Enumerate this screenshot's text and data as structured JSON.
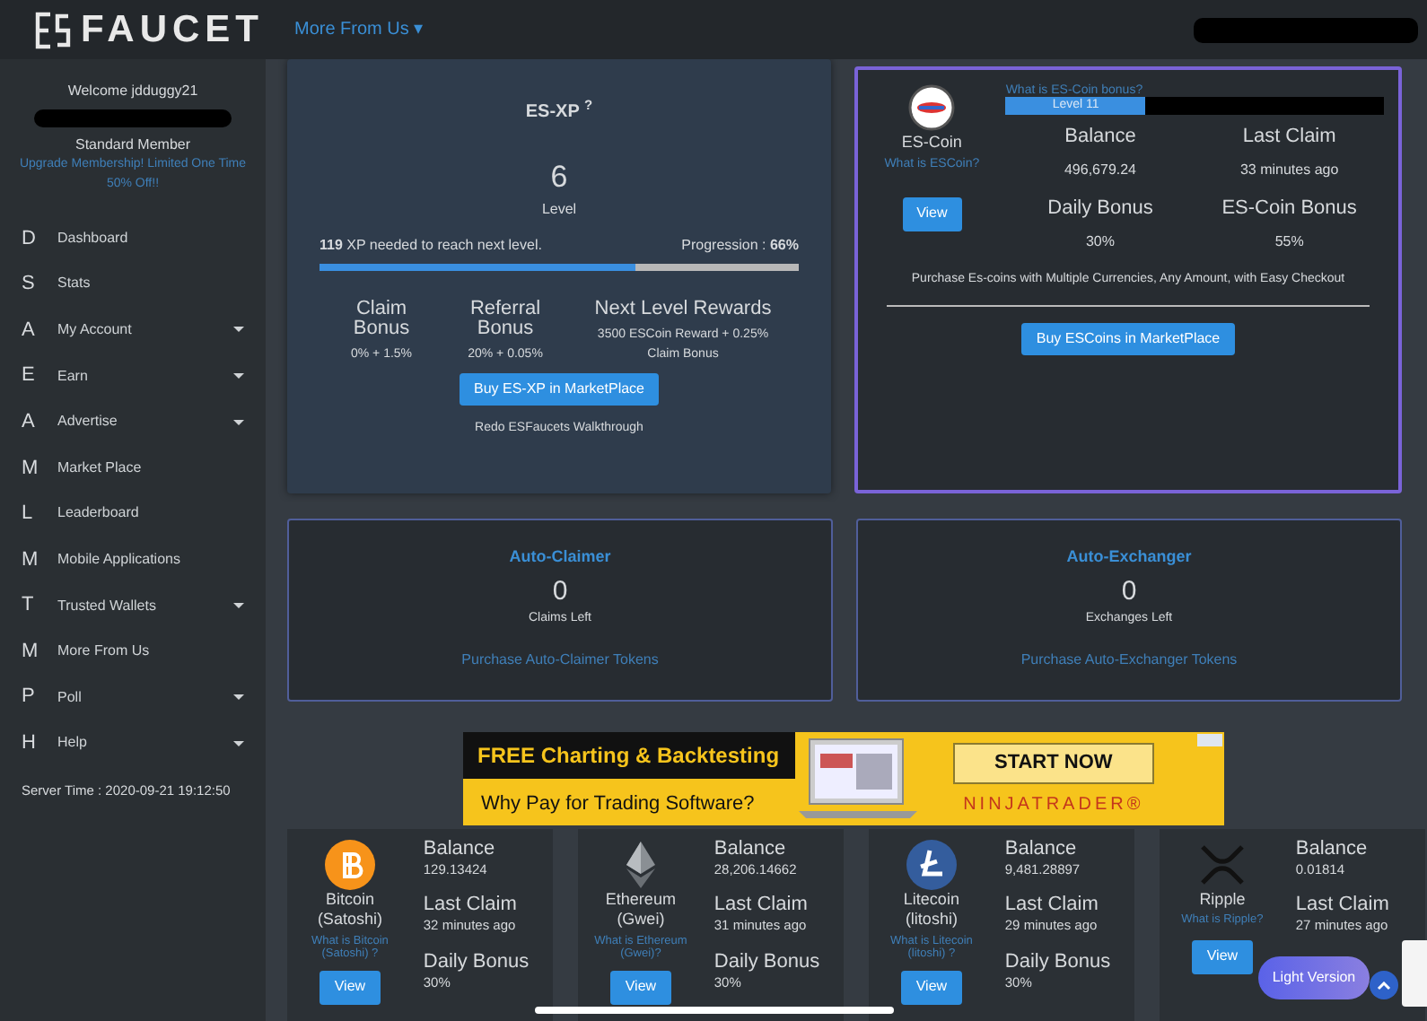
{
  "navbar": {
    "brand": "FAUCET",
    "menu": "More From Us",
    "menu_caret": "▾"
  },
  "sidebar": {
    "welcome": "Welcome jdduggy21",
    "membership": "Standard Member",
    "upgrade_link": "Upgrade Membership! Limited One Time 50% Off!!",
    "items": [
      {
        "letter": "D",
        "label": "Dashboard",
        "expandable": false
      },
      {
        "letter": "S",
        "label": "Stats",
        "expandable": false
      },
      {
        "letter": "A",
        "label": "My Account",
        "expandable": true
      },
      {
        "letter": "E",
        "label": "Earn",
        "expandable": true
      },
      {
        "letter": "A",
        "label": "Advertise",
        "expandable": true
      },
      {
        "letter": "M",
        "label": "Market Place",
        "expandable": false
      },
      {
        "letter": "L",
        "label": "Leaderboard",
        "expandable": false
      },
      {
        "letter": "M",
        "label": "Mobile Applications",
        "expandable": false
      },
      {
        "letter": "T",
        "label": "Trusted Wallets",
        "expandable": true
      },
      {
        "letter": "M",
        "label": "More From Us",
        "expandable": false
      },
      {
        "letter": "P",
        "label": "Poll",
        "expandable": true
      },
      {
        "letter": "H",
        "label": "Help",
        "expandable": true
      }
    ],
    "server_time": "Server Time : 2020-09-21 19:12:50"
  },
  "xp_card": {
    "title": "ES-XP $^{?}$",
    "level_value": "6",
    "level_label": "Level",
    "xp_needed": "**119** XP needed to reach next level.",
    "progression": "Progression : **66%**",
    "level": 0.66,
    "stats": [
      {
        "label": "Claim Bonus",
        "value": "0% + 1.5%"
      },
      {
        "label": "Referral Bonus",
        "value": "20% + 0.05%"
      },
      {
        "label": "Next Level Rewards",
        "value": "3500 ESCoin Reward + 0.25% Claim Bonus"
      }
    ],
    "buy_button": "Buy ES-XP in MarketPlace",
    "walkthrough": "Redo ESFaucets Walkthrough"
  },
  "coin_card": {
    "name": "ES-Coin",
    "what_link": "What is ESCoin?",
    "view_button": "View",
    "bonus_link": "What is ES-Coin bonus?",
    "bonus_level_label": "Level 11",
    "level": 0.37,
    "stats": [
      {
        "label": "Balance",
        "value": "496,679.24"
      },
      {
        "label": "Last Claim",
        "value": "33 minutes ago"
      },
      {
        "label": "Daily Bonus",
        "value": "30%"
      },
      {
        "label": "ES-Coin Bonus",
        "value": "55%"
      }
    ],
    "purchase_text": "Purchase Es-coins with Multiple Currencies, Any Amount, with Easy Checkout",
    "buy_button": "Buy ESCoins in MarketPlace"
  },
  "auto_cards": [
    {
      "title": "Auto-Claimer",
      "count": "0",
      "count_label": "Claims Left",
      "link": "Purchase Auto-Claimer Tokens"
    },
    {
      "title": "Auto-Exchanger",
      "count": "0",
      "count_label": "Exchanges Left",
      "link": "Purchase Auto-Exchanger Tokens"
    }
  ],
  "ad_banner": {
    "headline": "FREE Charting & Backtesting",
    "subline": "Why Pay for Trading Software?",
    "cta": "START NOW",
    "brand": "NINJATRADER®"
  },
  "currencies": [
    {
      "kind": "bitcoin",
      "name": "Bitcoin (Satoshi)",
      "what_link": "What is Bitcoin (Satoshi) ?",
      "balance_label": "Balance",
      "balance": "129.13424",
      "claim_label": "Last Claim",
      "last_claim": "32 minutes ago",
      "bonus_label": "Daily Bonus",
      "daily_bonus": "30%",
      "view_button": "View"
    },
    {
      "kind": "ethereum",
      "name": "Ethereum (Gwei)",
      "what_link": "What is Ethereum (Gwei)?",
      "balance_label": "Balance",
      "balance": "28,206.14662",
      "claim_label": "Last Claim",
      "last_claim": "31 minutes ago",
      "bonus_label": "Daily Bonus",
      "daily_bonus": "30%",
      "view_button": "View"
    },
    {
      "kind": "litecoin",
      "name": "Litecoin (litoshi)",
      "what_link": "What is Litecoin (litoshi) ?",
      "balance_label": "Balance",
      "balance": "9,481.28897",
      "claim_label": "Last Claim",
      "last_claim": "29 minutes ago",
      "bonus_label": "Daily Bonus",
      "daily_bonus": "30%",
      "view_button": "View"
    },
    {
      "kind": "ripple",
      "name": "Ripple",
      "what_link": "What is Ripple?",
      "balance_label": "Balance",
      "balance": "0.01814",
      "claim_label": "Last Claim",
      "last_claim": "27 minutes ago",
      "view_button": "View"
    }
  ],
  "light_version_button": "Light Version"
}
